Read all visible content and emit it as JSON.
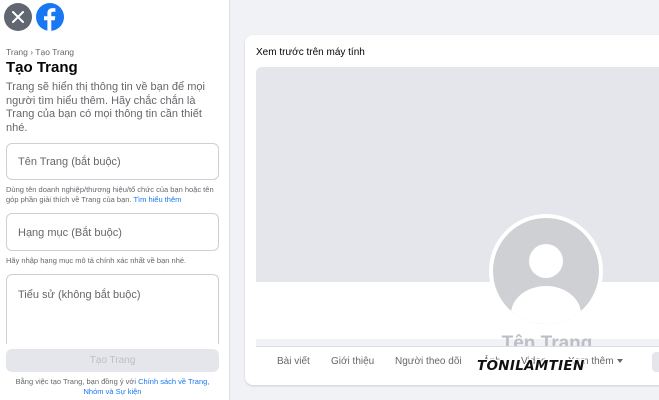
{
  "breadcrumb": "Trang › Tạo Trang",
  "title": "Tạo Trang",
  "description": "Trang sẽ hiển thị thông tin về bạn để mọi người tìm hiểu thêm. Hãy chắc chắn là Trang của bạn có mọi thông tin cần thiết nhé.",
  "fields": {
    "name_placeholder": "Tên Trang (bắt buộc)",
    "name_hint": "Dùng tên doanh nghiệp/thương hiệu/tổ chức của bạn hoặc tên góp phần giải thích về Trang của bạn.",
    "name_hint_link": "Tìm hiểu thêm",
    "category_placeholder": "Hạng mục (Bắt buộc)",
    "category_hint": "Hãy nhập hạng mục mô tả chính xác nhất về bạn nhé.",
    "bio_placeholder": "Tiểu sử (không bắt buộc)"
  },
  "create_button": "Tạo Trang",
  "terms": {
    "prefix": "Bằng việc tạo Trang, bạn đồng ý với",
    "link": "Chính sách về Trang, Nhóm và Sự kiện"
  },
  "preview": {
    "title": "Xem trước trên máy tính",
    "page_name": "Tên Trang",
    "tabs": [
      "Bài viết",
      "Giới thiệu",
      "Người theo dõi",
      "Ảnh",
      "Video",
      "Xem thêm"
    ]
  },
  "watermark": "TONILAMTIEN",
  "colors": {
    "brand": "#1877f2",
    "background": "#f0f2f5",
    "muted_text": "#65676b"
  },
  "icons": [
    "close-icon",
    "facebook-logo-icon",
    "avatar-placeholder-icon",
    "chevron-down-icon"
  ]
}
